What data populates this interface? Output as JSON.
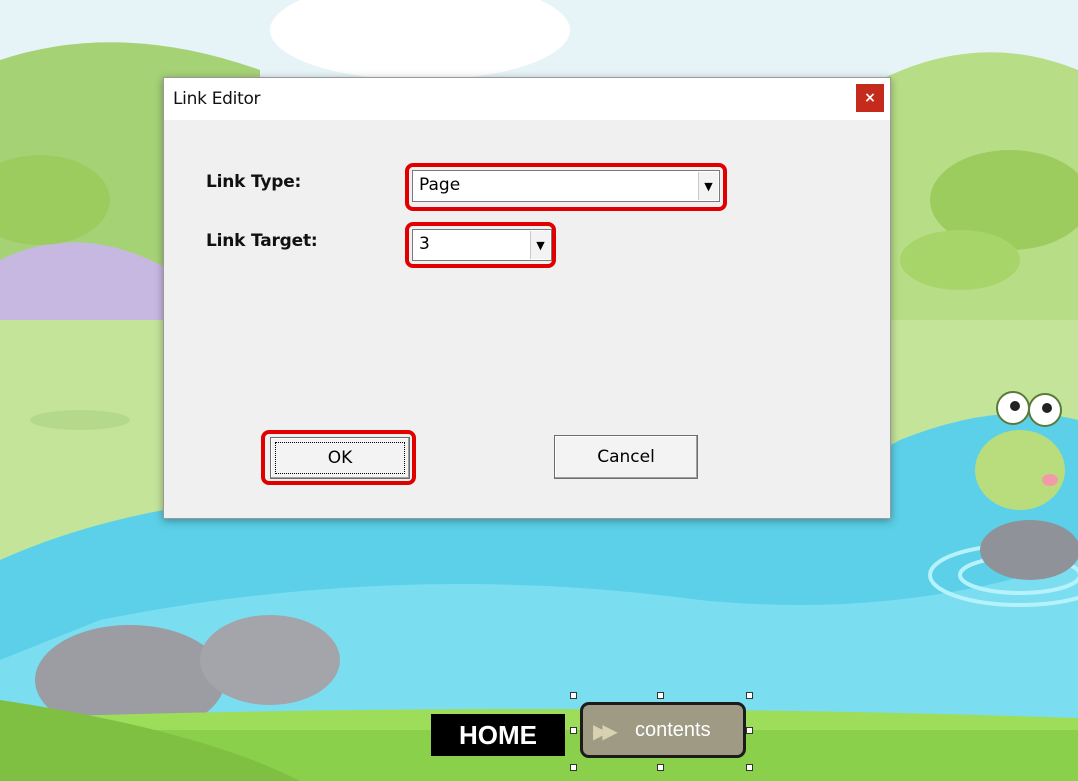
{
  "dialog": {
    "title": "Link Editor",
    "close_glyph": "×",
    "link_type_label": "Link Type:",
    "link_type_value": "Page",
    "link_target_label": "Link Target:",
    "link_target_value": "3",
    "ok_label": "OK",
    "cancel_label": "Cancel",
    "dropdown_icon": "chevron-down-icon",
    "close_color": "#c42b1c"
  },
  "nav": {
    "home_label": "HOME",
    "contents_label": "contents",
    "contents_icon": "fast-forward-icon"
  },
  "annotation": {
    "highlight_color": "#e00000"
  }
}
